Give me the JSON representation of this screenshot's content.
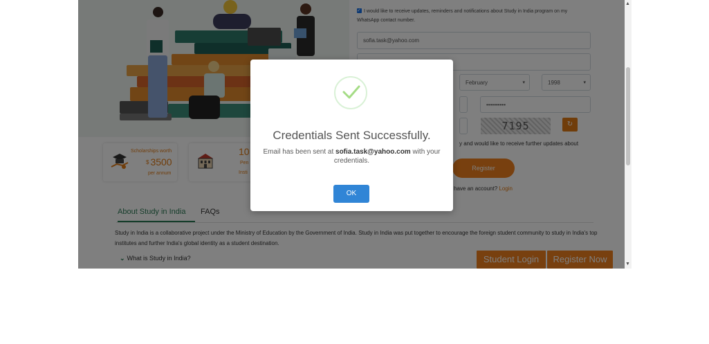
{
  "form": {
    "whatsapp_consent": "I would like to receive updates, reminders and notifications about Study in India program on my WhatsApp contact number.",
    "email_value": "sofia.task@yahoo.com",
    "dob_month": "February",
    "dob_year": "1998",
    "password_mask": "••••••••••",
    "captcha_text": "7195",
    "consent_partial": "y and would like to receive further updates about",
    "register_label": "Register",
    "login_prompt": "have an account?",
    "login_link": "Login"
  },
  "stats": {
    "scholarship_title": "Scholarships worth",
    "scholarship_currency": "$",
    "scholarship_amount": "3500",
    "scholarship_period": "per annum",
    "institutes_number": "10",
    "institutes_line1": "Pen",
    "institutes_line2": "Insti"
  },
  "tabs": [
    "About Study in India",
    "FAQs"
  ],
  "about_text": "Study in India is a collaborative project under the Ministry of Education by the Government of India. Study in India was put together to encourage the foreign student community to study in India's top institutes and further India's global identity as a student destination.",
  "faq_item": "What is Study in India?",
  "cta": {
    "student_login": "Student Login",
    "register_now": "Register Now"
  },
  "modal": {
    "title": "Credentials Sent Successfully.",
    "msg_prefix": "Email has been sent at",
    "msg_email": "sofia.task@yahoo.com",
    "msg_suffix": "with your credentials.",
    "ok_label": "OK"
  },
  "icons": [
    "success-check-icon",
    "scholarship-icon",
    "institute-icon",
    "refresh-icon",
    "chevron-down-icon",
    "checkbox-checked-icon"
  ],
  "colors": {
    "accent_orange": "#f0811f",
    "brand_green": "#2b7a55",
    "ok_blue": "#3085d6",
    "success_green": "#a5dc86"
  }
}
